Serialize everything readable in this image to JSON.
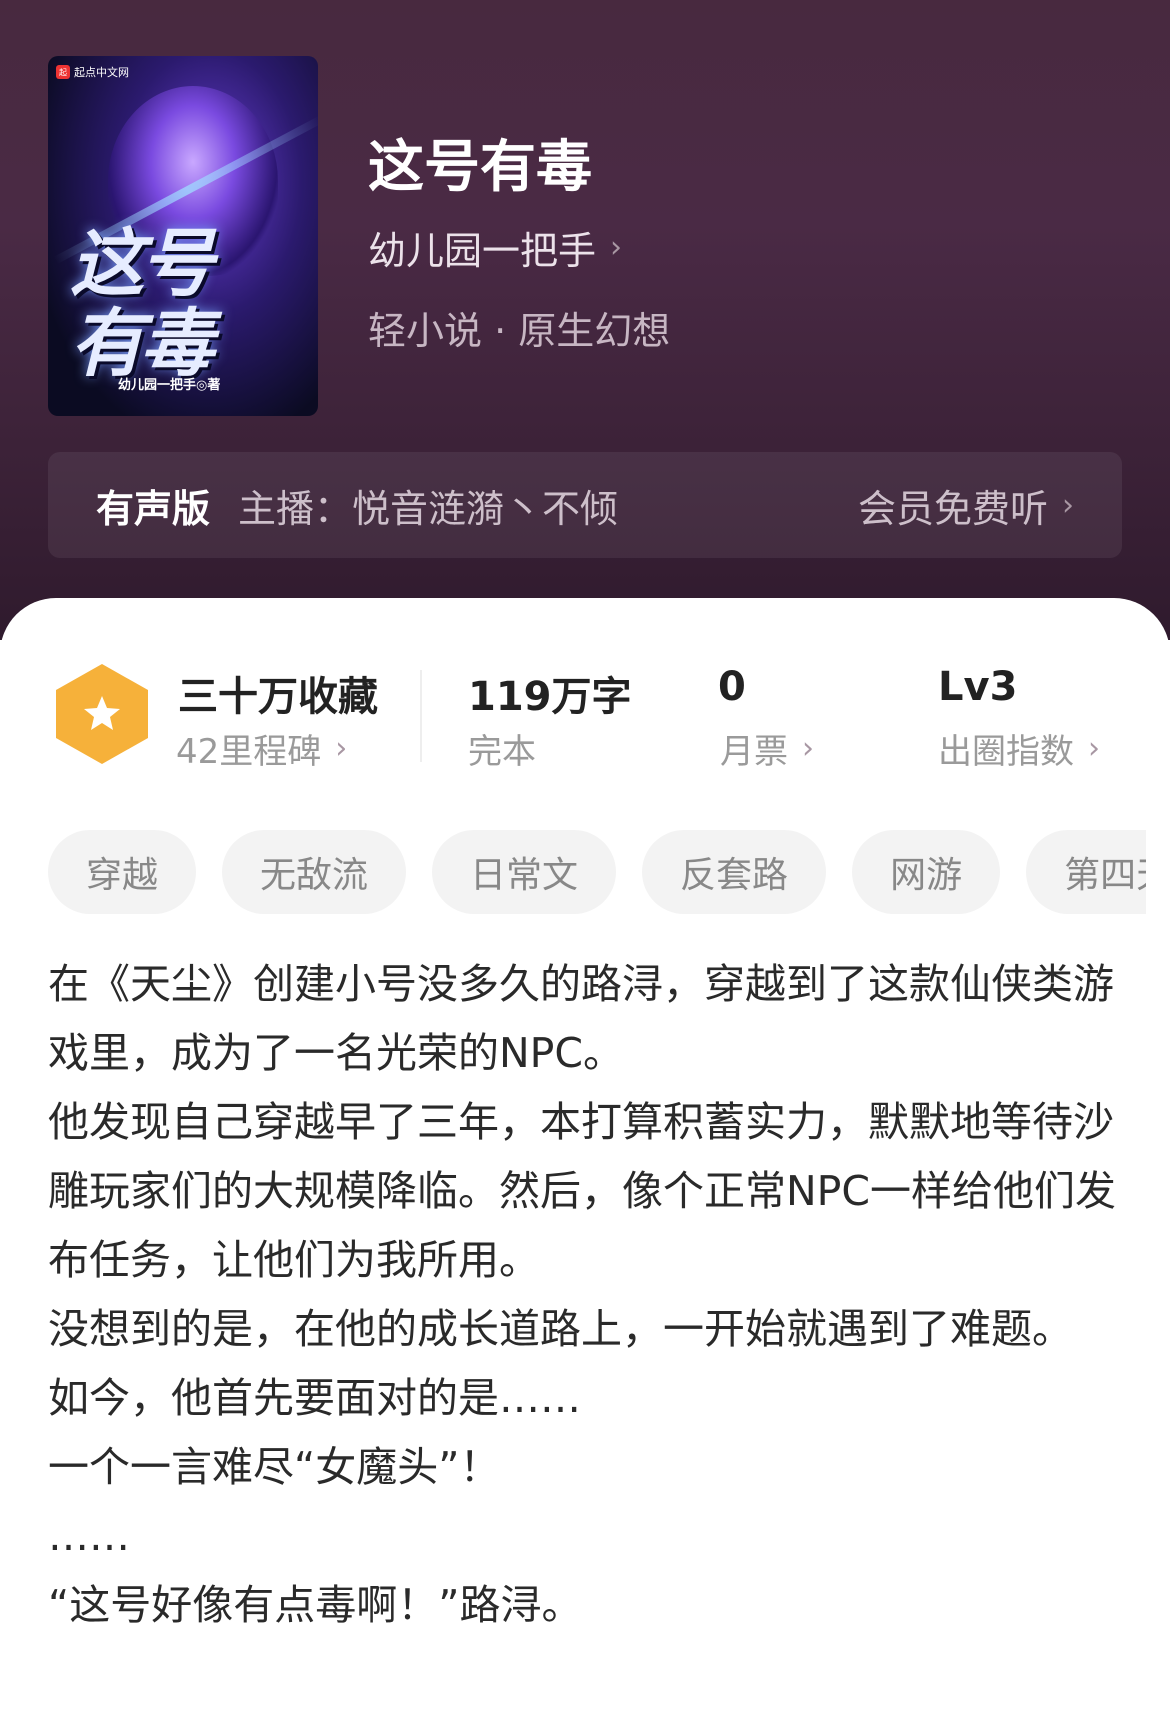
{
  "book": {
    "title": "这号有毒",
    "author": "幼儿园一把手",
    "genre": "轻小说 · 原生幻想",
    "cover": {
      "publisher": "起点中文网",
      "title_line1": "这号",
      "title_line2": "有毒",
      "author_text": "幼儿园一把手◎著"
    }
  },
  "audio": {
    "label": "有声版",
    "host": "主播：悦音涟漪丶不倾",
    "action": "会员免费听"
  },
  "stats": {
    "favorites": {
      "value": "三十万收藏",
      "sub": "42里程碑"
    },
    "words": {
      "value": "119万字",
      "sub": "完本"
    },
    "monthly_ticket": {
      "value": "0",
      "sub": "月票"
    },
    "circle_index": {
      "value": "Lv3",
      "sub": "出圈指数"
    }
  },
  "tags": [
    "穿越",
    "无敌流",
    "日常文",
    "反套路",
    "网游",
    "第四天"
  ],
  "synopsis": [
    "在《天尘》创建小号没多久的路浔，穿越到了这款仙侠类游戏里，成为了一名光荣的NPC。",
    "他发现自己穿越早了三年，本打算积蓄实力，默默地等待沙雕玩家们的大规模降临。然后，像个正常NPC一样给他们发布任务，让他们为我所用。",
    "没想到的是，在他的成长道路上，一开始就遇到了难题。",
    "如今，他首先要面对的是……",
    "一个一言难尽“女魔头”！",
    "……",
    "“这号好像有点毒啊！”路浔。"
  ],
  "colors": {
    "header_bg": "#48293f",
    "badge": "#f6b13a",
    "tag_bg": "#f3f3f3"
  },
  "icons": [
    "chevron-right-icon",
    "star-badge-icon"
  ]
}
